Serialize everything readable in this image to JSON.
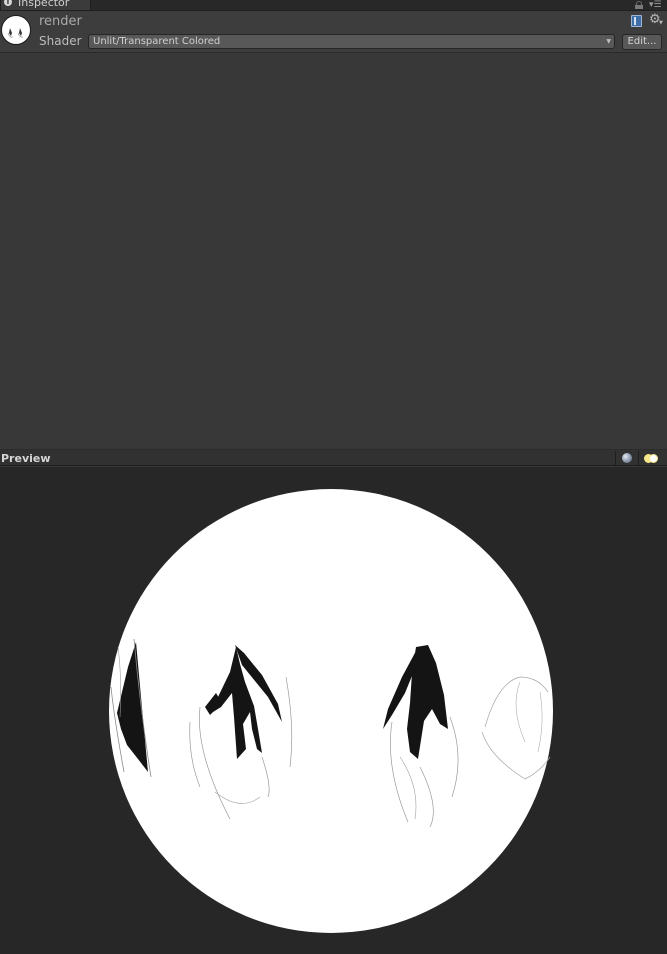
{
  "tab": {
    "title": "Inspector",
    "info_icon": "info-icon",
    "lock_icon": "lock-icon",
    "menu_icon": "tab-menu-icon"
  },
  "material": {
    "name": "render",
    "shader_label": "Shader",
    "shader_value": "Unlit/Transparent Colored",
    "edit_label": "Edit...",
    "help_icon": "help-book-icon",
    "settings_icon": "gear-icon"
  },
  "preview": {
    "title": "Preview",
    "mesh_toggle_icon": "sphere-mesh-icon",
    "light_toggle_icon": "light-toggle-icon"
  },
  "colors": {
    "panel_bg": "#383838",
    "viewport_bg": "#272727",
    "sphere": "#ffffff",
    "ink": "#141414",
    "accent_book": "#3f6ea8"
  }
}
